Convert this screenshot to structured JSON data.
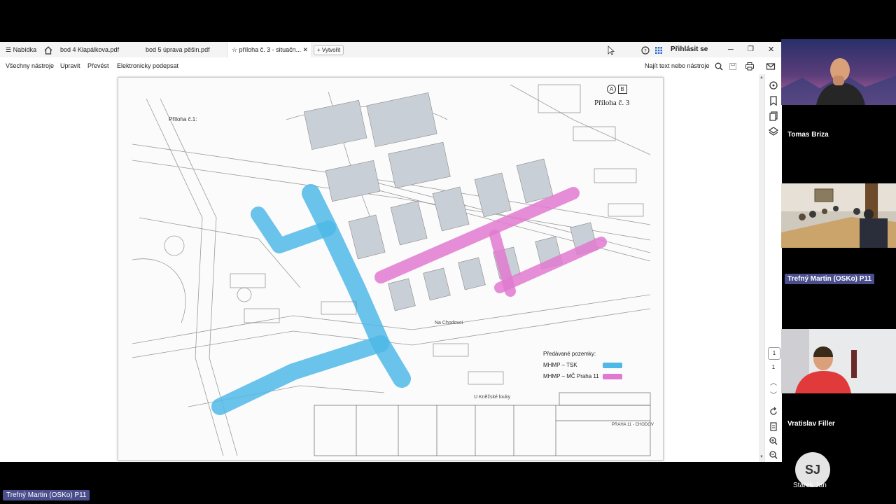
{
  "tabs": {
    "menu": "Nabídka",
    "tab1": "bod 4 Klapálkova.pdf",
    "tab2": "bod 5 úprava pěšin.pdf",
    "tab3": "příloha č. 3 - situačn...",
    "new_tab": "Vytvořit",
    "sign_in": "Přihlásit se"
  },
  "toolbar": {
    "all_tools": "Všechny nástroje",
    "edit": "Upravit",
    "convert": "Převést",
    "esign": "Elektronicky podepsat",
    "search": "Najít text nebo nástroje"
  },
  "document": {
    "annex_top_right": "Příloha č. 3",
    "annex_left": "Příloha č.1:",
    "sheet_marks": [
      "A",
      "B"
    ],
    "street_label": "Na Chodovci",
    "street_label2": "U Kněžské louky",
    "legend_title": "Předávané pozemky:",
    "legend": [
      {
        "label": "MHMP – TSK",
        "color": "#4fb8e6"
      },
      {
        "label": "MHMP – MČ Praha 11",
        "color": "#e07ad0"
      }
    ],
    "title_block_text": "PRAHA 11 - CHODOV"
  },
  "page_nav": {
    "box": "1",
    "total": "1"
  },
  "participants": [
    {
      "name": "Tomas Briza"
    },
    {
      "name": "Trefný Martin (OSKo) P11"
    },
    {
      "name": "Vratislav Filler"
    },
    {
      "name": "Stárek Jan",
      "initials": "SJ"
    }
  ],
  "bottom_speaker": "Trefný Martin (OSKo) P11",
  "colors": {
    "tsk": "#4fb8e6",
    "mc": "#e07ad0",
    "badge": "#4a4e8c"
  }
}
